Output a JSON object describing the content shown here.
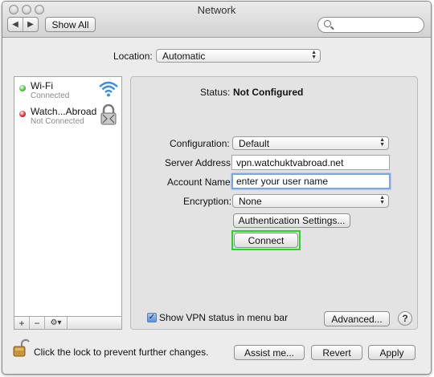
{
  "window": {
    "title": "Network"
  },
  "toolbar": {
    "show_all_label": "Show All",
    "search_placeholder": ""
  },
  "location": {
    "label": "Location:",
    "value": "Automatic"
  },
  "sidebar": {
    "services": [
      {
        "name": "Wi-Fi",
        "status": "Connected",
        "status_color": "#3dbb32",
        "icon": "wifi-icon"
      },
      {
        "name": "Watch...Abroad",
        "status": "Not Connected",
        "status_color": "#d81e1e",
        "icon": "vpn-lock-icon"
      }
    ],
    "toolbar": {
      "add": "+",
      "remove": "−",
      "action": "⚙▾"
    }
  },
  "detail": {
    "status_label": "Status:",
    "status_value": "Not Configured",
    "configuration_label": "Configuration:",
    "configuration_value": "Default",
    "server_address_label": "Server Address:",
    "server_address_value": "vpn.watchuktvabroad.net",
    "account_name_label": "Account Name:",
    "account_name_value": "enter your user name",
    "encryption_label": "Encryption:",
    "encryption_value": "None",
    "auth_settings_label": "Authentication Settings...",
    "connect_label": "Connect",
    "highlight_color": "#22d71f",
    "show_vpn_label": "Show VPN status in menu bar",
    "show_vpn_checked": true,
    "advanced_label": "Advanced...",
    "help_label": "?"
  },
  "footer": {
    "lock_text": "Click the lock to prevent further changes.",
    "assist_label": "Assist me...",
    "revert_label": "Revert",
    "apply_label": "Apply"
  }
}
